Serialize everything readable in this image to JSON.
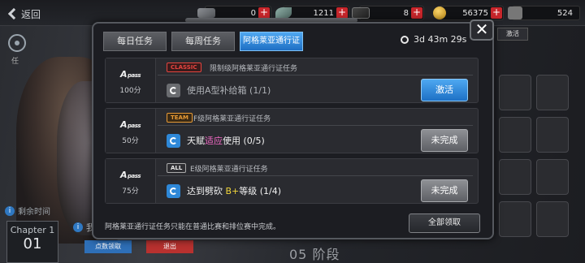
{
  "topbar": {
    "back_label": "返回",
    "resources": [
      {
        "name": "ticket",
        "value": "0"
      },
      {
        "name": "feather",
        "value": "1211"
      },
      {
        "name": "card",
        "value": "8"
      },
      {
        "name": "coin",
        "value": "56375"
      },
      {
        "name": "gear",
        "value": "524"
      }
    ]
  },
  "background": {
    "left_icon_text": "任",
    "remain_text": "剩余时间",
    "chapter_label": "Chapter 1",
    "chapter_number": "01",
    "left_extra_text": "我",
    "btn_collect_points": "点数领取",
    "btn_exit": "退出",
    "stage_text": "05 阶段",
    "activate_side": "激活"
  },
  "modal": {
    "tabs": [
      {
        "label": "每日任务",
        "active": false
      },
      {
        "label": "每周任务",
        "active": false
      },
      {
        "label": "阿格莱亚通行证",
        "active": true
      }
    ],
    "timer": "3d 43m 29s",
    "close_label": "✕",
    "missions": [
      {
        "pass_label": "A",
        "pass_sub": "pass",
        "points": "100分",
        "badge": "CLASSIC",
        "badge_type": "classic",
        "title": "限制级阿格莱亚通行证任务",
        "text_parts": [
          "使用A型补给箱 (1/1)"
        ],
        "button": "激活",
        "button_style": "blue",
        "icon_style": "grey"
      },
      {
        "pass_label": "A",
        "pass_sub": "pass",
        "points": "50分",
        "badge": "TEAM",
        "badge_type": "team",
        "title": "F级阿格莱亚通行证任务",
        "text_parts": [
          "天赋",
          "适应",
          "使用 (0/5)"
        ],
        "button": "未完成",
        "button_style": "grey",
        "icon_style": "blue"
      },
      {
        "pass_label": "A",
        "pass_sub": "pass",
        "points": "75分",
        "badge": "ALL",
        "badge_type": "all",
        "title": "E级阿格莱亚通行证任务",
        "text_parts": [
          "达到劈砍 ",
          "B+",
          "等级 (1/4)"
        ],
        "button": "未完成",
        "button_style": "grey",
        "icon_style": "blue"
      }
    ],
    "footer_note": "阿格莱亚通行证任务只能在普通比赛和排位赛中完成。",
    "collect_all": "全部领取"
  }
}
